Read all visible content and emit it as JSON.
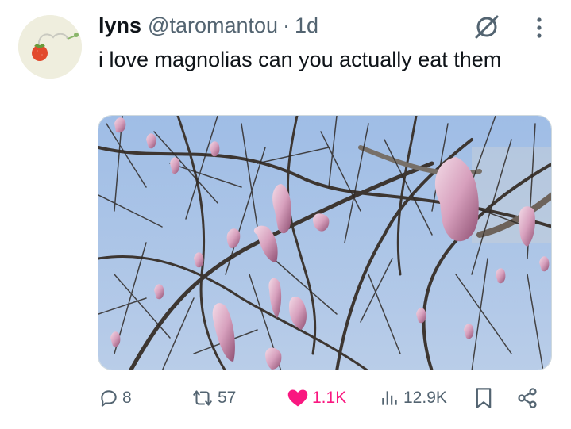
{
  "tweet": {
    "display_name": "lyns",
    "handle": "@taromantou",
    "separator": "·",
    "time": "1d",
    "text": "i love magnolias can you actually eat them"
  },
  "actions": {
    "replies": "8",
    "reposts": "57",
    "likes": "1.1K",
    "views": "12.9K"
  },
  "icons": {
    "grok": "grok-icon",
    "more": "more-vertical-icon",
    "reply": "reply-icon",
    "repost": "repost-icon",
    "like": "heart-filled-icon",
    "views": "views-icon",
    "bookmark": "bookmark-icon",
    "share": "share-icon"
  },
  "colors": {
    "text": "#0f1419",
    "secondary": "#536471",
    "like": "#f91880",
    "sky": "#a9c3e6",
    "blossom": "#d9a3bd"
  }
}
